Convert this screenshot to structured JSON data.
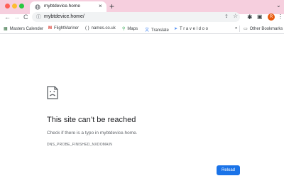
{
  "tab": {
    "title": "mybtdevice.home",
    "close": "×"
  },
  "newtab": "+",
  "tab_dropdown": "⌄",
  "nav": {
    "back": "←",
    "forward": "→",
    "reload": "C"
  },
  "omnibox": {
    "url": "mybtdevice.home/"
  },
  "avatar_initial": "R",
  "bookmarks": {
    "items": [
      "Masters Calender",
      "FlightMariner",
      "names.co.uk",
      "Maps",
      "Translate",
      "T r a v e l d o o"
    ],
    "more": "»",
    "other": "Other Bookmarks"
  },
  "error": {
    "heading": "This site can’t be reached",
    "message": "Check if there is a typo in mybtdevice.home.",
    "code": "DNS_PROBE_FINISHED_NXDOMAIN",
    "reload_label": "Reload"
  },
  "colors": {
    "titlebar": "#f6cfde",
    "accent": "#1a73e8",
    "avatar": "#e8590c"
  }
}
